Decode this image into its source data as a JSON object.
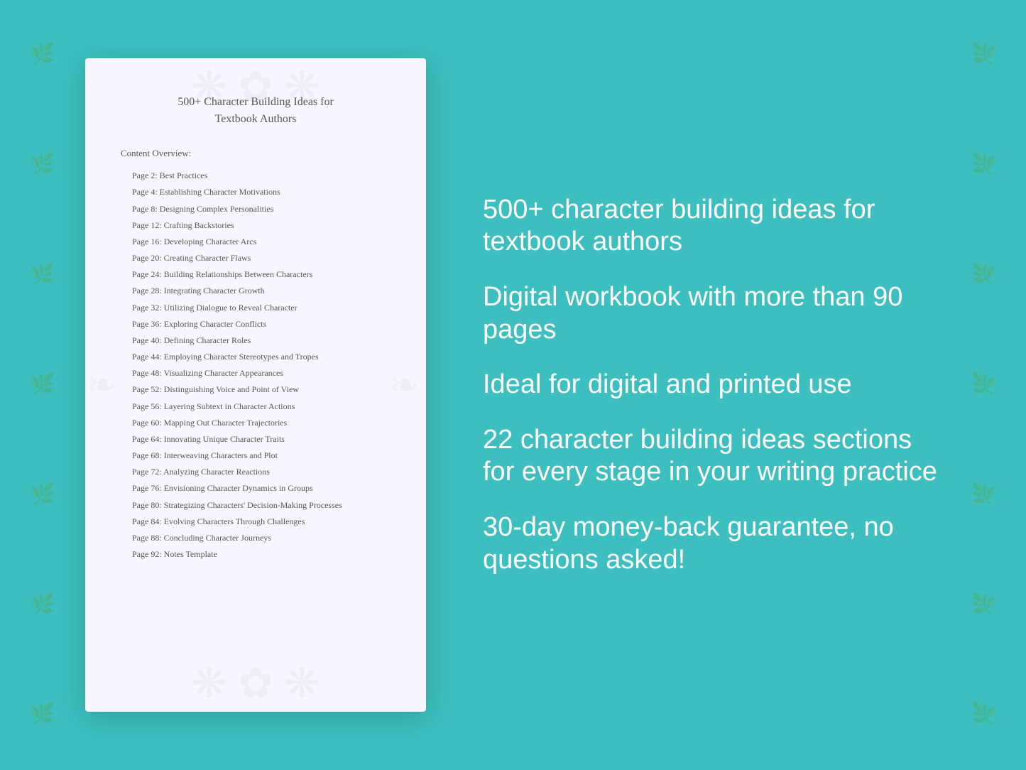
{
  "background_color": "#3dbfbf",
  "document": {
    "title_line1": "500+ Character Building Ideas for",
    "title_line2": "Textbook Authors",
    "content_label": "Content Overview:",
    "toc": [
      {
        "page": "Page  2:",
        "title": "Best Practices"
      },
      {
        "page": "Page  4:",
        "title": "Establishing Character Motivations"
      },
      {
        "page": "Page  8:",
        "title": "Designing Complex Personalities"
      },
      {
        "page": "Page 12:",
        "title": "Crafting Backstories"
      },
      {
        "page": "Page 16:",
        "title": "Developing Character Arcs"
      },
      {
        "page": "Page 20:",
        "title": "Creating Character Flaws"
      },
      {
        "page": "Page 24:",
        "title": "Building Relationships Between Characters"
      },
      {
        "page": "Page 28:",
        "title": "Integrating Character Growth"
      },
      {
        "page": "Page 32:",
        "title": "Utilizing Dialogue to Reveal Character"
      },
      {
        "page": "Page 36:",
        "title": "Exploring Character Conflicts"
      },
      {
        "page": "Page 40:",
        "title": "Defining Character Roles"
      },
      {
        "page": "Page 44:",
        "title": "Employing Character Stereotypes and Tropes"
      },
      {
        "page": "Page 48:",
        "title": "Visualizing Character Appearances"
      },
      {
        "page": "Page 52:",
        "title": "Distinguishing Voice and Point of View"
      },
      {
        "page": "Page 56:",
        "title": "Layering Subtext in Character Actions"
      },
      {
        "page": "Page 60:",
        "title": "Mapping Out Character Trajectories"
      },
      {
        "page": "Page 64:",
        "title": "Innovating Unique Character Traits"
      },
      {
        "page": "Page 68:",
        "title": "Interweaving Characters and Plot"
      },
      {
        "page": "Page 72:",
        "title": "Analyzing Character Reactions"
      },
      {
        "page": "Page 76:",
        "title": "Envisioning Character Dynamics in Groups"
      },
      {
        "page": "Page 80:",
        "title": "Strategizing Characters' Decision-Making Processes"
      },
      {
        "page": "Page 84:",
        "title": "Evolving Characters Through Challenges"
      },
      {
        "page": "Page 88:",
        "title": "Concluding Character Journeys"
      },
      {
        "page": "Page 92:",
        "title": "Notes Template"
      }
    ]
  },
  "promo": {
    "points": [
      "500+ character building ideas for textbook authors",
      "Digital workbook with more than 90 pages",
      "Ideal for digital and printed use",
      "22 character building ideas sections for every stage in your writing practice",
      "30-day money-back guarantee, no questions asked!"
    ]
  },
  "floral": {
    "sprig_symbol": "❧"
  }
}
